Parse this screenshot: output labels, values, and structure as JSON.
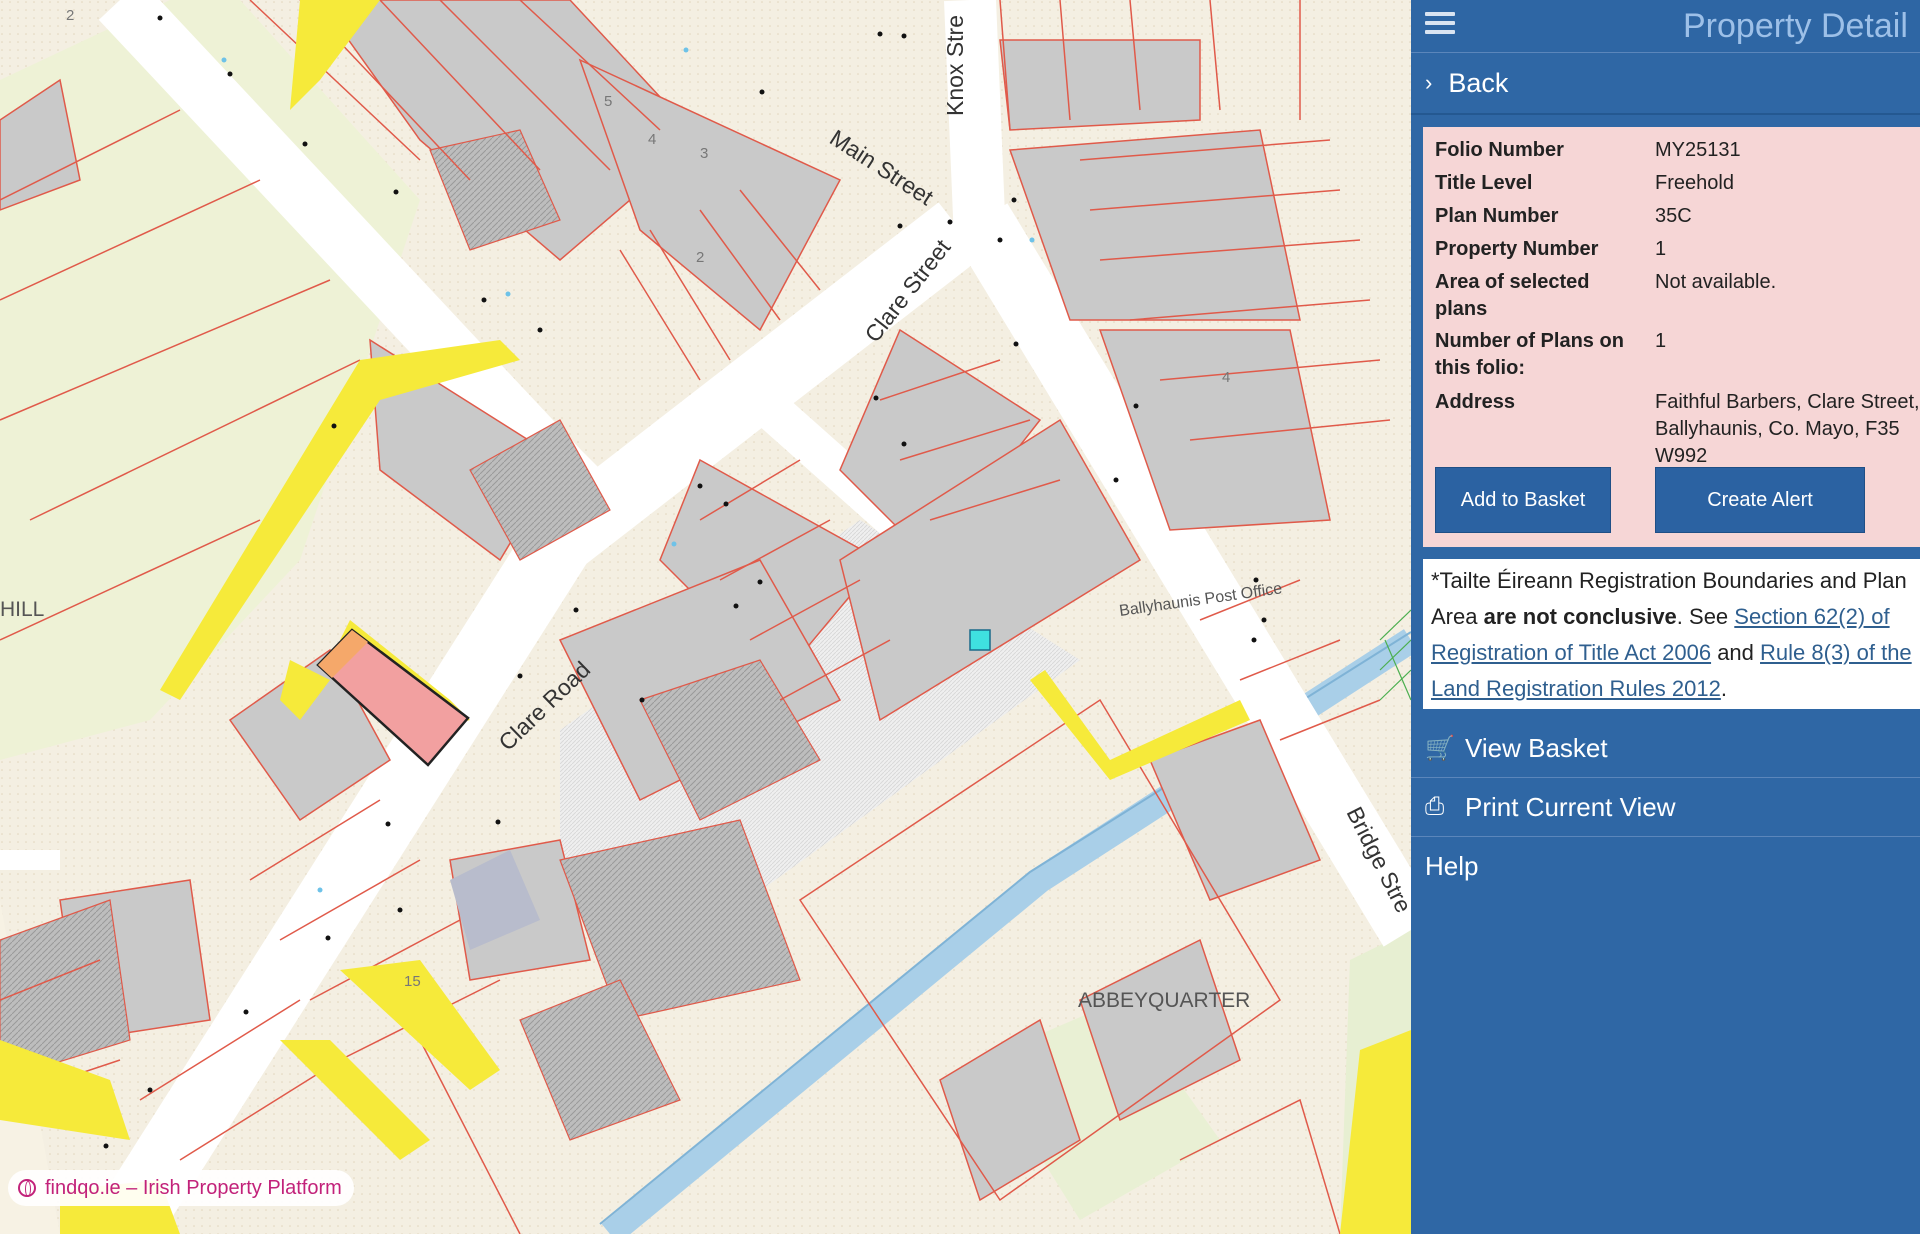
{
  "map": {
    "streets": {
      "main_street": "Main Street",
      "knox_street": "Knox Stre",
      "clare_street": "Clare Street",
      "clare_road": "Clare Road",
      "bridge_street": "Bridge Stre"
    },
    "places": {
      "abbeyquarter": "ABBEYQUARTER",
      "hill": "HILL",
      "post_office": "Ballyhaunis Post Office"
    },
    "house_numbers": [
      "2",
      "5",
      "4",
      "3",
      "2",
      "4",
      "15"
    ],
    "colors": {
      "background": "#f4efe2",
      "road": "#ffffff",
      "parcel_line": "#e05a4a",
      "building": "#c9c9c9",
      "selected_parcel": "#f2a0a0",
      "highlight_yellow": "#f6ea3a",
      "river": "#a9cfe8",
      "marker": "#3fe0e0"
    }
  },
  "panel": {
    "title": "Property Detail",
    "back_label": "Back",
    "details": [
      {
        "key": "Folio Number",
        "value": "MY25131"
      },
      {
        "key": "Title Level",
        "value": "Freehold"
      },
      {
        "key": "Plan Number",
        "value": "35C"
      },
      {
        "key": "Property Number",
        "value": "1"
      },
      {
        "key": "Area of selected plans",
        "value": "Not available."
      },
      {
        "key": "Number of Plans on this folio:",
        "value": "1"
      },
      {
        "key": "Address",
        "value": "Faithful Barbers, Clare Street, Ballyhaunis, Co. Mayo, F35 W992"
      }
    ],
    "buttons": {
      "add_to_basket": "Add to Basket",
      "create_alert": "Create Alert"
    },
    "notice": {
      "intro": "*Tailte Éireann Registration Boundaries and Plan Area",
      "bold": "are not conclusive",
      "mid": ". See",
      "link1": "Section 62(2) of Registration of Title Act 2006",
      "and": "and",
      "link2": "Rule 8(3) of the Land Registration Rules 2012",
      "end": "."
    },
    "menu": [
      {
        "label": "View Basket",
        "icon": "cart-icon"
      },
      {
        "label": "Print Current View",
        "icon": "print-icon"
      },
      {
        "label": "Help",
        "icon": ""
      }
    ],
    "colors": {
      "panel": "#2f67a5",
      "details_bg": "#f6d6d6",
      "button": "#2b62a2"
    }
  },
  "watermark": {
    "text": "findqo.ie – Irish Property Platform"
  }
}
